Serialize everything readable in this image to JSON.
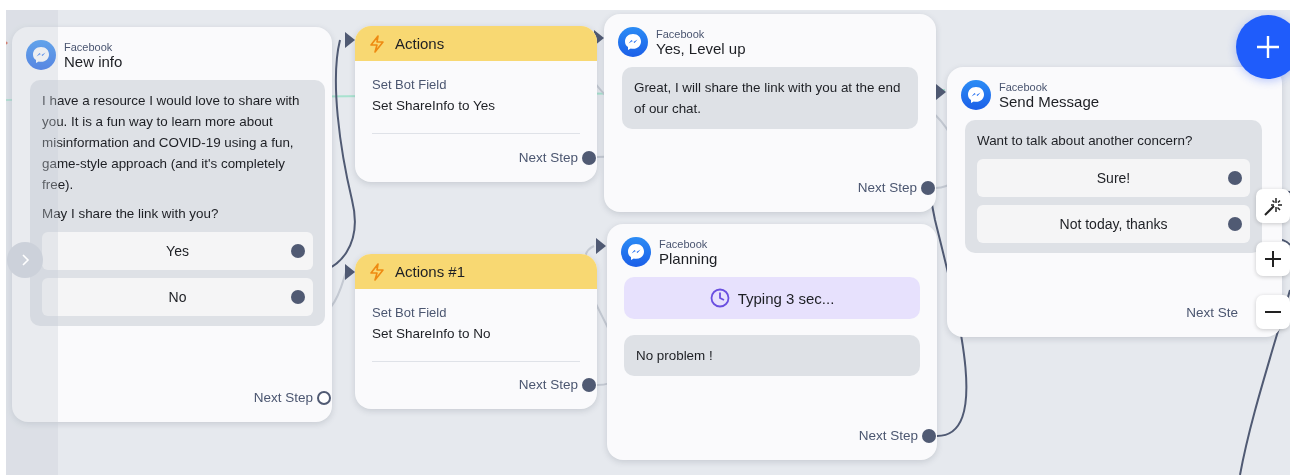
{
  "canvas": {
    "nodes": [
      {
        "kind": "message",
        "channel": "Facebook",
        "title": "New info",
        "blocks": [
          {
            "kind": "text",
            "paragraphs": [
              "I have a resource I would love to share with you. It is a fun way to learn more about misinformation and COVID-19 using a fun, game-style approach (and it's completely free).",
              "May I share the link with you?"
            ],
            "quick_replies": [
              {
                "label": "Yes",
                "connected": true
              },
              {
                "label": "No",
                "connected": true
              }
            ]
          }
        ],
        "next_step": {
          "label": "Next Step",
          "connected": false
        }
      },
      {
        "kind": "action",
        "title": "Actions",
        "field": "Set Bot Field",
        "value": "Set ShareInfo to Yes",
        "next_step": {
          "label": "Next Step",
          "connected": true
        }
      },
      {
        "kind": "action",
        "title": "Actions #1",
        "field": "Set Bot Field",
        "value": "Set ShareInfo to No",
        "next_step": {
          "label": "Next Step",
          "connected": true
        }
      },
      {
        "kind": "message",
        "channel": "Facebook",
        "title": "Yes, Level up",
        "blocks": [
          {
            "kind": "text",
            "paragraphs": [
              "Great, I will share the link with you at the end of our chat."
            ]
          }
        ],
        "next_step": {
          "label": "Next Step",
          "connected": true
        }
      },
      {
        "kind": "message",
        "channel": "Facebook",
        "title": "Planning",
        "blocks": [
          {
            "kind": "typing",
            "text": "Typing 3 sec..."
          },
          {
            "kind": "text",
            "paragraphs": [
              "No problem !"
            ]
          }
        ],
        "next_step": {
          "label": "Next Step",
          "connected": true
        }
      },
      {
        "kind": "message",
        "channel": "Facebook",
        "title": "Send Message",
        "blocks": [
          {
            "kind": "text",
            "paragraphs": [
              "Want to talk about another concern?"
            ],
            "quick_replies": [
              {
                "label": "Sure!",
                "connected": true
              },
              {
                "label": "Not today, thanks",
                "connected": true
              }
            ]
          }
        ],
        "next_step": {
          "label": "Next Ste"
        }
      }
    ]
  }
}
